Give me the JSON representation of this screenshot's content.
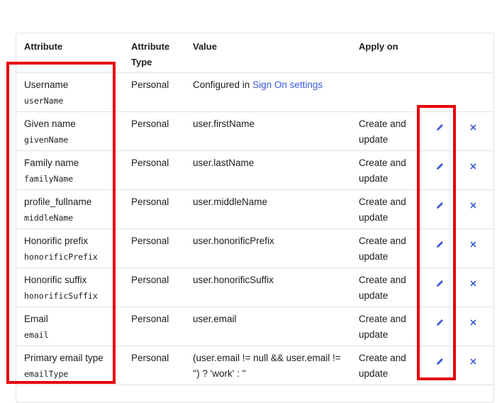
{
  "table": {
    "headers": {
      "attribute": "Attribute",
      "attribute_type_line1": "Attribute",
      "attribute_type_line2": "Type",
      "value": "Value",
      "apply_on": "Apply on"
    },
    "rows": [
      {
        "name": "Username",
        "code": "userName",
        "type": "Personal",
        "value_prefix": "Configured in ",
        "value_link": "Sign On settings",
        "apply1": "",
        "apply2": "",
        "editable": false
      },
      {
        "name": "Given name",
        "code": "givenName",
        "type": "Personal",
        "value": "user.firstName",
        "apply1": "Create and",
        "apply2": "update",
        "editable": true
      },
      {
        "name": "Family name",
        "code": "familyName",
        "type": "Personal",
        "value": "user.lastName",
        "apply1": "Create and",
        "apply2": "update",
        "editable": true
      },
      {
        "name": "profile_fullname",
        "code": "middleName",
        "type": "Personal",
        "value": "user.middleName",
        "apply1": "Create and",
        "apply2": "update",
        "editable": true
      },
      {
        "name": "Honorific prefix",
        "code": "honorificPrefix",
        "type": "Personal",
        "value": "user.honorificPrefix",
        "apply1": "Create and",
        "apply2": "update",
        "editable": true
      },
      {
        "name": "Honorific suffix",
        "code": "honorificSuffix",
        "type": "Personal",
        "value": "user.honorificSuffix",
        "apply1": "Create and",
        "apply2": "update",
        "editable": true
      },
      {
        "name": "Email",
        "code": "email",
        "type": "Personal",
        "value": "user.email",
        "apply1": "Create and",
        "apply2": "update",
        "editable": true
      },
      {
        "name": "Primary email type",
        "code": "emailType",
        "type": "Personal",
        "value1": "(user.email != null && user.email !=",
        "value2": "'') ? 'work' : ''",
        "apply1": "Create and",
        "apply2": "update",
        "editable": true
      }
    ]
  },
  "icons": {
    "edit": "pencil-icon",
    "delete": "close-icon"
  },
  "colors": {
    "accent": "#3b5bdb",
    "highlight": "#e8000b",
    "border": "#e1e1e2"
  }
}
